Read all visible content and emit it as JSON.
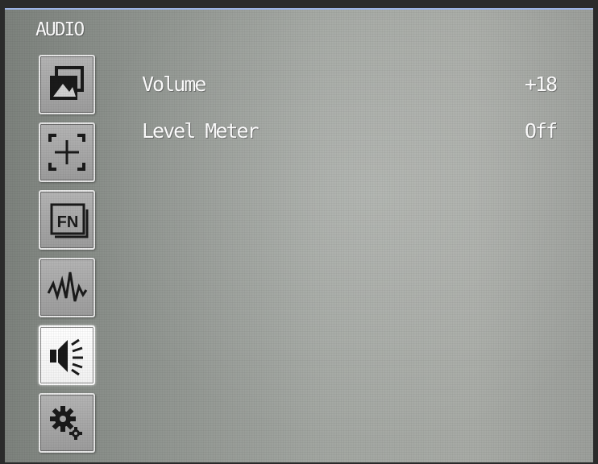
{
  "menu": {
    "title": "AUDIO"
  },
  "sidebar": {
    "tabs": [
      {
        "icon": "picture-icon",
        "active": false
      },
      {
        "icon": "marker-icon",
        "active": false
      },
      {
        "icon": "fn-icon",
        "active": false,
        "text": "FN"
      },
      {
        "icon": "waveform-icon",
        "active": false
      },
      {
        "icon": "speaker-icon",
        "active": true
      },
      {
        "icon": "gear-icon",
        "active": false
      }
    ]
  },
  "settings": [
    {
      "label": "Volume",
      "value": "+18"
    },
    {
      "label": "Level Meter",
      "value": "Off"
    }
  ],
  "colors": {
    "text": "#ffffff",
    "tab_border": "#e8e8e8",
    "tab_fill": "#a8a8a8",
    "tab_active_fill": "#ffffff",
    "icon": "#1a1a1a",
    "screen_top_border": "#9db4e6"
  }
}
